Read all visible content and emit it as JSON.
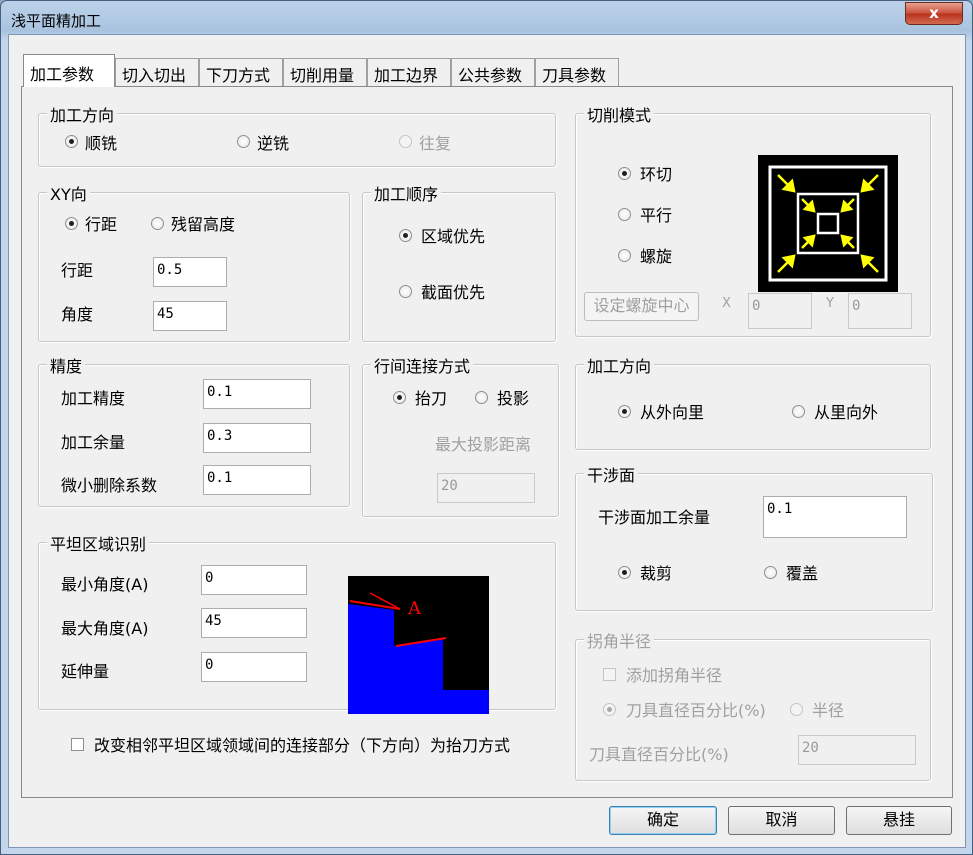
{
  "window": {
    "title": "浅平面精加工",
    "close_label": "x"
  },
  "tabs": [
    "加工参数",
    "切入切出",
    "下刀方式",
    "切削用量",
    "加工边界",
    "公共参数",
    "刀具参数"
  ],
  "direction_group": {
    "title": "加工方向",
    "options": [
      "顺铣",
      "逆铣",
      "往复"
    ],
    "selected": "顺铣",
    "disabled": [
      "往复"
    ]
  },
  "xy_group": {
    "title": "XY向",
    "options": [
      "行距",
      "残留高度"
    ],
    "selected": "行距",
    "row_label": "行距",
    "row_value": "0.5",
    "angle_label": "角度",
    "angle_value": "45"
  },
  "order_group": {
    "title": "加工顺序",
    "options": [
      "区域优先",
      "截面优先"
    ],
    "selected": "区域优先"
  },
  "precision_group": {
    "title": "精度",
    "fields": [
      {
        "label": "加工精度",
        "value": "0.1"
      },
      {
        "label": "加工余量",
        "value": "0.3"
      },
      {
        "label": "微小删除系数",
        "value": "0.1"
      }
    ]
  },
  "link_group": {
    "title": "行间连接方式",
    "options": [
      "抬刀",
      "投影"
    ],
    "selected": "抬刀",
    "max_label": "最大投影距离",
    "max_value": "20"
  },
  "flat_group": {
    "title": "平坦区域识别",
    "fields": [
      {
        "label": "最小角度(A)",
        "value": "0"
      },
      {
        "label": "最大角度(A)",
        "value": "45"
      },
      {
        "label": "延伸量",
        "value": "0"
      }
    ],
    "image_label": "A"
  },
  "bottom_checkbox": {
    "label": "改变相邻平坦区域领域间的连接部分（下方向）为抬刀方式",
    "checked": false
  },
  "cut_mode_group": {
    "title": "切削模式",
    "options": [
      "环切",
      "平行",
      "螺旋"
    ],
    "selected": "环切",
    "spiral_button": "设定螺旋中心",
    "x_label": "X",
    "x_value": "0",
    "y_label": "Y",
    "y_value": "0"
  },
  "process_dir_group": {
    "title": "加工方向",
    "options": [
      "从外向里",
      "从里向外"
    ],
    "selected": "从外向里"
  },
  "interfere_group": {
    "title": "干涉面",
    "allowance_label": "干涉面加工余量",
    "allowance_value": "0.1",
    "options": [
      "裁剪",
      "覆盖"
    ],
    "selected": "裁剪"
  },
  "corner_group": {
    "title": "拐角半径",
    "add_label": "添加拐角半径",
    "options": [
      "刀具直径百分比(%)",
      "半径"
    ],
    "selected": "刀具直径百分比(%)",
    "pct_label": "刀具直径百分比(%)",
    "pct_value": "20"
  },
  "footer": {
    "ok": "确定",
    "cancel": "取消",
    "hang": "悬挂"
  },
  "colors": {
    "accent_yellow": "#ffff00",
    "flat_blue": "#0000ff",
    "flat_red": "#ff0000"
  }
}
